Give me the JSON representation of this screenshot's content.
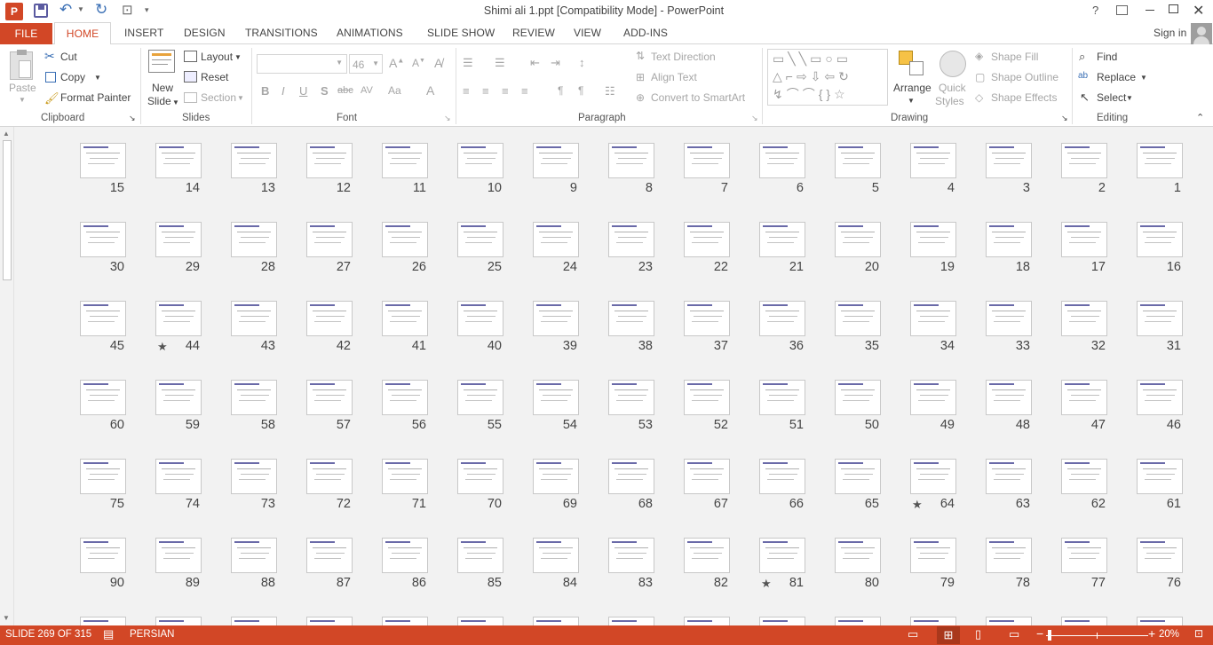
{
  "app": {
    "title": "Shimi ali 1.ppt [Compatibility Mode] - PowerPoint",
    "help": "?",
    "accent": "#d24726",
    "sign_in": "Sign in"
  },
  "tabs": [
    "FILE",
    "HOME",
    "INSERT",
    "DESIGN",
    "TRANSITIONS",
    "ANIMATIONS",
    "SLIDE SHOW",
    "REVIEW",
    "VIEW",
    "ADD-INS"
  ],
  "ribbon": {
    "clipboard": {
      "paste": "Paste",
      "cut": "Cut",
      "copy": "Copy",
      "format_painter": "Format Painter",
      "label": "Clipboard"
    },
    "slides": {
      "new_slide_1": "New",
      "new_slide_2": "Slide",
      "layout": "Layout",
      "reset": "Reset",
      "section": "Section",
      "label": "Slides"
    },
    "font": {
      "size": "46",
      "label": "Font"
    },
    "paragraph": {
      "text_direction": "Text Direction",
      "align_text": "Align Text",
      "smartart": "Convert to SmartArt",
      "label": "Paragraph"
    },
    "drawing": {
      "arrange": "Arrange",
      "quick_styles_1": "Quick",
      "quick_styles_2": "Styles",
      "shape_fill": "Shape Fill",
      "shape_outline": "Shape Outline",
      "shape_effects": "Shape Effects",
      "label": "Drawing"
    },
    "editing": {
      "find": "Find",
      "replace": "Replace",
      "select": "Select",
      "label": "Editing"
    }
  },
  "slides": {
    "rows": [
      [
        "15",
        "14",
        "13",
        "12",
        "11",
        "10",
        "9",
        "8",
        "7",
        "6",
        "5",
        "4",
        "3",
        "2",
        "1"
      ],
      [
        "30",
        "29",
        "28",
        "27",
        "26",
        "25",
        "24",
        "23",
        "22",
        "21",
        "20",
        "19",
        "18",
        "17",
        "16"
      ],
      [
        "45",
        "44",
        "43",
        "42",
        "41",
        "40",
        "39",
        "38",
        "37",
        "36",
        "35",
        "34",
        "33",
        "32",
        "31"
      ],
      [
        "60",
        "59",
        "58",
        "57",
        "56",
        "55",
        "54",
        "53",
        "52",
        "51",
        "50",
        "49",
        "48",
        "47",
        "46"
      ],
      [
        "75",
        "74",
        "73",
        "72",
        "71",
        "70",
        "69",
        "68",
        "67",
        "66",
        "65",
        "64",
        "63",
        "62",
        "61"
      ],
      [
        "90",
        "89",
        "88",
        "87",
        "86",
        "85",
        "84",
        "83",
        "82",
        "81",
        "80",
        "79",
        "78",
        "77",
        "76"
      ]
    ],
    "starred": [
      "44",
      "64",
      "81"
    ]
  },
  "status": {
    "slide": "SLIDE 269 OF 315",
    "language": "PERSIAN",
    "zoom": "20%"
  }
}
